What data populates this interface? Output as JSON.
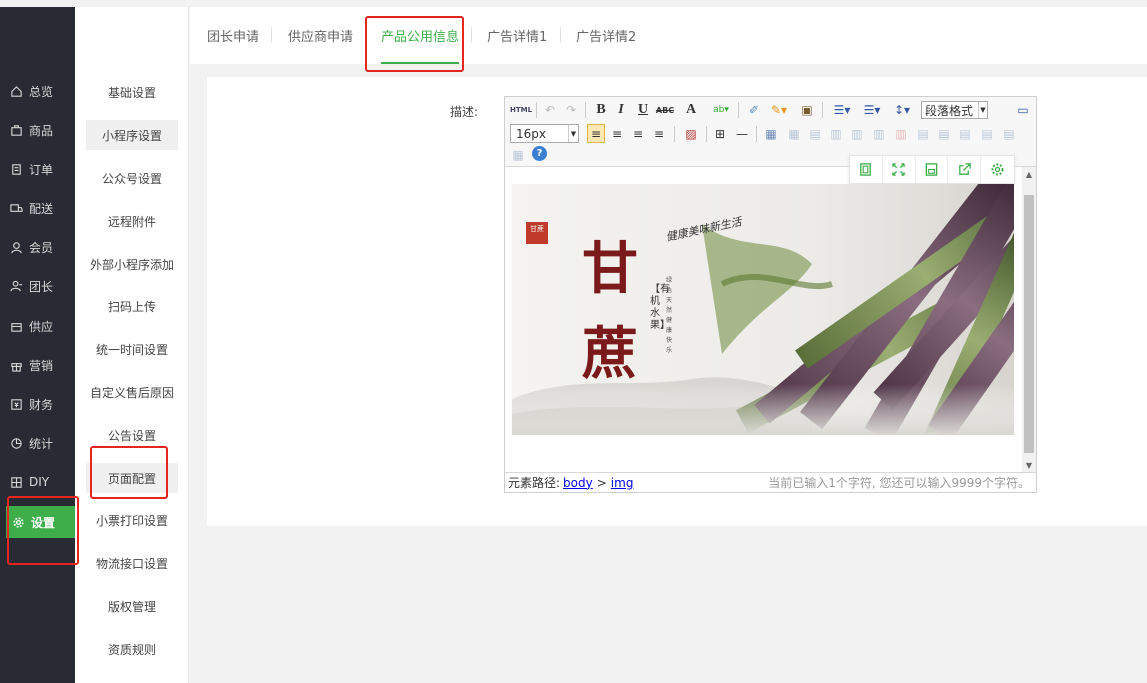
{
  "sidebar": {
    "items": [
      {
        "label": "总览",
        "icon": "home-icon"
      },
      {
        "label": "商品",
        "icon": "goods-icon"
      },
      {
        "label": "订单",
        "icon": "order-icon"
      },
      {
        "label": "配送",
        "icon": "delivery-icon"
      },
      {
        "label": "会员",
        "icon": "member-icon"
      },
      {
        "label": "团长",
        "icon": "leader-icon"
      },
      {
        "label": "供应",
        "icon": "supply-icon"
      },
      {
        "label": "营销",
        "icon": "gift-icon"
      },
      {
        "label": "财务",
        "icon": "finance-icon"
      },
      {
        "label": "统计",
        "icon": "pie-chart-icon"
      },
      {
        "label": "DIY",
        "icon": "layout-icon"
      },
      {
        "label": "设置",
        "icon": "gear-icon"
      }
    ]
  },
  "submenu": {
    "items": [
      "基础设置",
      "小程序设置",
      "公众号设置",
      "远程附件",
      "外部小程序添加",
      "扫码上传",
      "统一时间设置",
      "自定义售后原因",
      "公告设置",
      "页面配置",
      "小票打印设置",
      "物流接口设置",
      "版权管理",
      "资质规则"
    ]
  },
  "tabs": [
    "团长申请",
    "供应商申请",
    "产品公用信息",
    "广告详情1",
    "广告详情2"
  ],
  "form": {
    "desc_label": "描述:"
  },
  "editor": {
    "html_btn": "HTML",
    "bold": "B",
    "italic": "I",
    "underline": "U",
    "strike": "ABC",
    "fontcolor": "A",
    "font_size": "16px",
    "paragraph": "段落格式",
    "path_label": "元素路径:",
    "path_body": "body",
    "path_sep": ">",
    "path_img": "img",
    "char_count": "当前已输入1个字符, 您还可以输入9999个字符。"
  },
  "banner": {
    "title_1": "甘",
    "title_2": "蔗",
    "subtitle": "【有机水果】",
    "slogan": "健康美味新生活",
    "vertical_note": "绿色天然 健康快乐",
    "seal": "甘蔗"
  },
  "colors": {
    "sidebar_bg": "#282b33",
    "accent": "#3eae4a",
    "annotation": "#e5251e"
  }
}
